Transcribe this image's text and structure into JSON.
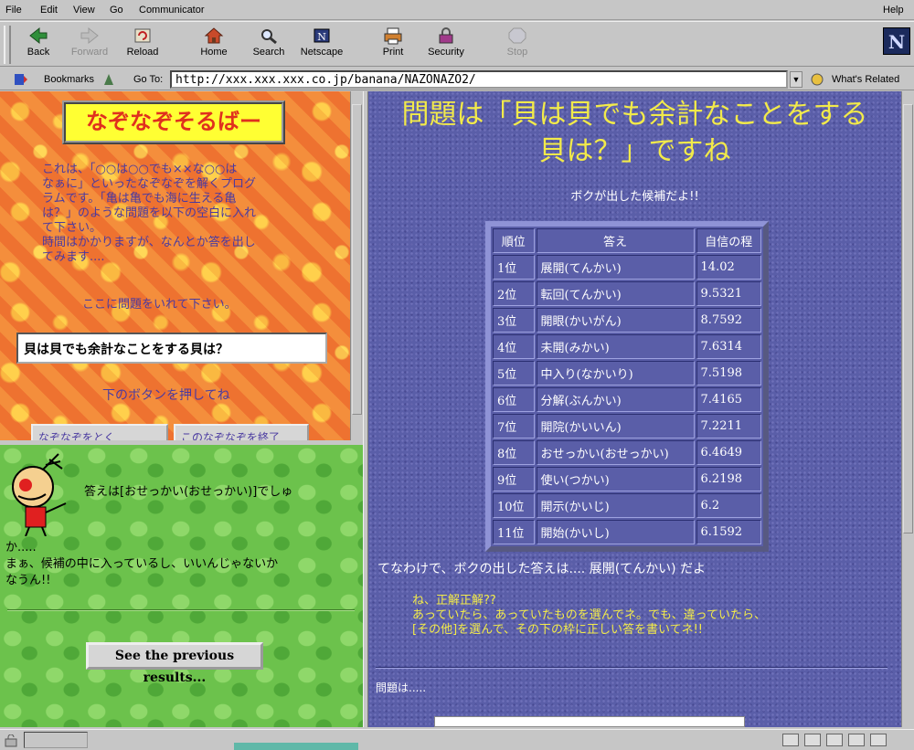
{
  "menubar": {
    "file": "File",
    "edit": "Edit",
    "view": "View",
    "go": "Go",
    "communicator": "Communicator",
    "help": "Help"
  },
  "toolbar": {
    "back": "Back",
    "forward": "Forward",
    "reload": "Reload",
    "home": "Home",
    "search": "Search",
    "netscape": "Netscape",
    "print": "Print",
    "security": "Security",
    "stop": "Stop",
    "logo": "N"
  },
  "locbar": {
    "bookmarks": "Bookmarks",
    "goto": "Go To:",
    "url": "http://xxx.xxx.xxx.co.jp/banana/NAZONAZO2/",
    "related": "What's Related"
  },
  "left_top": {
    "title": "なぞなぞそるばー",
    "intro": "これは、「○○は○○でも××な○○は\nなぁに」といったなぞなぞを解くプログ\nラムです。「亀は亀でも海に生える亀\nは？」のような問題を以下の空白に入れ\nて下さい。\n時間はかかりますが、なんとか答を出し\nてみます....",
    "prompt": "ここに問題をいれて下さい。",
    "question": "貝は貝でも余計なことをする貝は？",
    "press": "下のボタンを押してね",
    "button1": "なぞなぞをとく",
    "button2": "このなぞなぞを終了"
  },
  "left_bottom": {
    "answer": "答えは[おせっかい(おせっかい)]でしゅ",
    "comment": "か.....\nまぁ、候補の中に入っているし、いいんじゃないか\nなうん!!",
    "prev_button": "See the previous results..."
  },
  "right": {
    "headline": "問題は「貝は貝でも余計なことをする\n貝は？」ですね",
    "subhead": "ボクが出した候補だよ!!",
    "table": {
      "headers": [
        "順位",
        "答え",
        "自信の程"
      ],
      "rows": [
        [
          "1位",
          "展開(てんかい)",
          "14.02"
        ],
        [
          "2位",
          "転回(てんかい)",
          "9.5321"
        ],
        [
          "3位",
          "開眼(かいがん)",
          "8.7592"
        ],
        [
          "4位",
          "未開(みかい)",
          "7.6314"
        ],
        [
          "5位",
          "中入り(なかいり)",
          "7.5198"
        ],
        [
          "6位",
          "分解(ぶんかい)",
          "7.4165"
        ],
        [
          "7位",
          "開院(かいいん)",
          "7.2211"
        ],
        [
          "8位",
          "おせっかい(おせっかい)",
          "6.4649"
        ],
        [
          "9位",
          "使い(つかい)",
          "6.2198"
        ],
        [
          "10位",
          "開示(かいじ)",
          "6.2"
        ],
        [
          "11位",
          "開始(かいし)",
          "6.1592"
        ]
      ]
    },
    "conclusion": "てなわけで、ボクの出した答えは.... 展開(てんかい) だよ",
    "check": "ね、正解正解??\nあっていたら、あっていたものを選んでネ。でも、違っていたら、\n[その他]を選んで、その下の枠に正しい答を書いてネ!!",
    "mondai": "問題は....."
  }
}
